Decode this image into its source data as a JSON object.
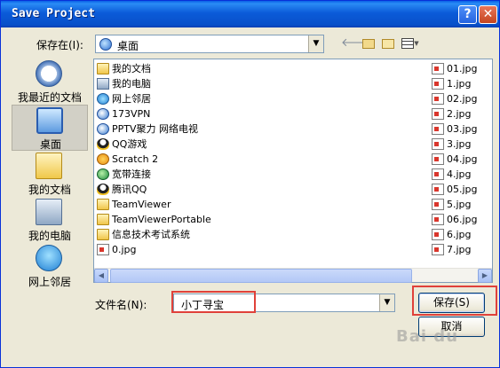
{
  "window": {
    "title": "Save Project",
    "help_button": "?",
    "close_button": "✕"
  },
  "lookin": {
    "label": "保存在(I):",
    "value": "桌面"
  },
  "places": [
    {
      "label": "我最近的文档",
      "icon": "recent-documents-icon"
    },
    {
      "label": "桌面",
      "icon": "desktop-icon"
    },
    {
      "label": "我的文档",
      "icon": "my-documents-icon"
    },
    {
      "label": "我的电脑",
      "icon": "my-computer-icon"
    },
    {
      "label": "网上邻居",
      "icon": "network-places-icon"
    }
  ],
  "files_left": [
    {
      "name": "我的文档",
      "icon": "folder-icon"
    },
    {
      "name": "我的电脑",
      "icon": "computer-icon"
    },
    {
      "name": "网上邻居",
      "icon": "network-icon"
    },
    {
      "name": "173VPN",
      "icon": "app-icon"
    },
    {
      "name": "PPTV聚力 网络电视",
      "icon": "app-icon"
    },
    {
      "name": "QQ游戏",
      "icon": "qq-icon"
    },
    {
      "name": "Scratch 2",
      "icon": "scratch-icon"
    },
    {
      "name": "宽带连接",
      "icon": "globe-icon"
    },
    {
      "name": "腾讯QQ",
      "icon": "qq-icon"
    },
    {
      "name": "TeamViewer",
      "icon": "folder-icon"
    },
    {
      "name": "TeamViewerPortable",
      "icon": "folder-icon"
    },
    {
      "name": "信息技术考试系统",
      "icon": "folder-icon"
    },
    {
      "name": "0.jpg",
      "icon": "jpg-icon"
    }
  ],
  "files_right": [
    {
      "name": "01.jpg"
    },
    {
      "name": "1.jpg"
    },
    {
      "name": "02.jpg"
    },
    {
      "name": "2.jpg"
    },
    {
      "name": "03.jpg"
    },
    {
      "name": "3.jpg"
    },
    {
      "name": "04.jpg"
    },
    {
      "name": "4.jpg"
    },
    {
      "name": "05.jpg"
    },
    {
      "name": "5.jpg"
    },
    {
      "name": "06.jpg"
    },
    {
      "name": "6.jpg"
    },
    {
      "name": "7.jpg"
    }
  ],
  "filename": {
    "label": "文件名(N):",
    "value": "小丁寻宝"
  },
  "buttons": {
    "save": "保存(S)",
    "cancel": "取消"
  },
  "watermark": "Bai du"
}
